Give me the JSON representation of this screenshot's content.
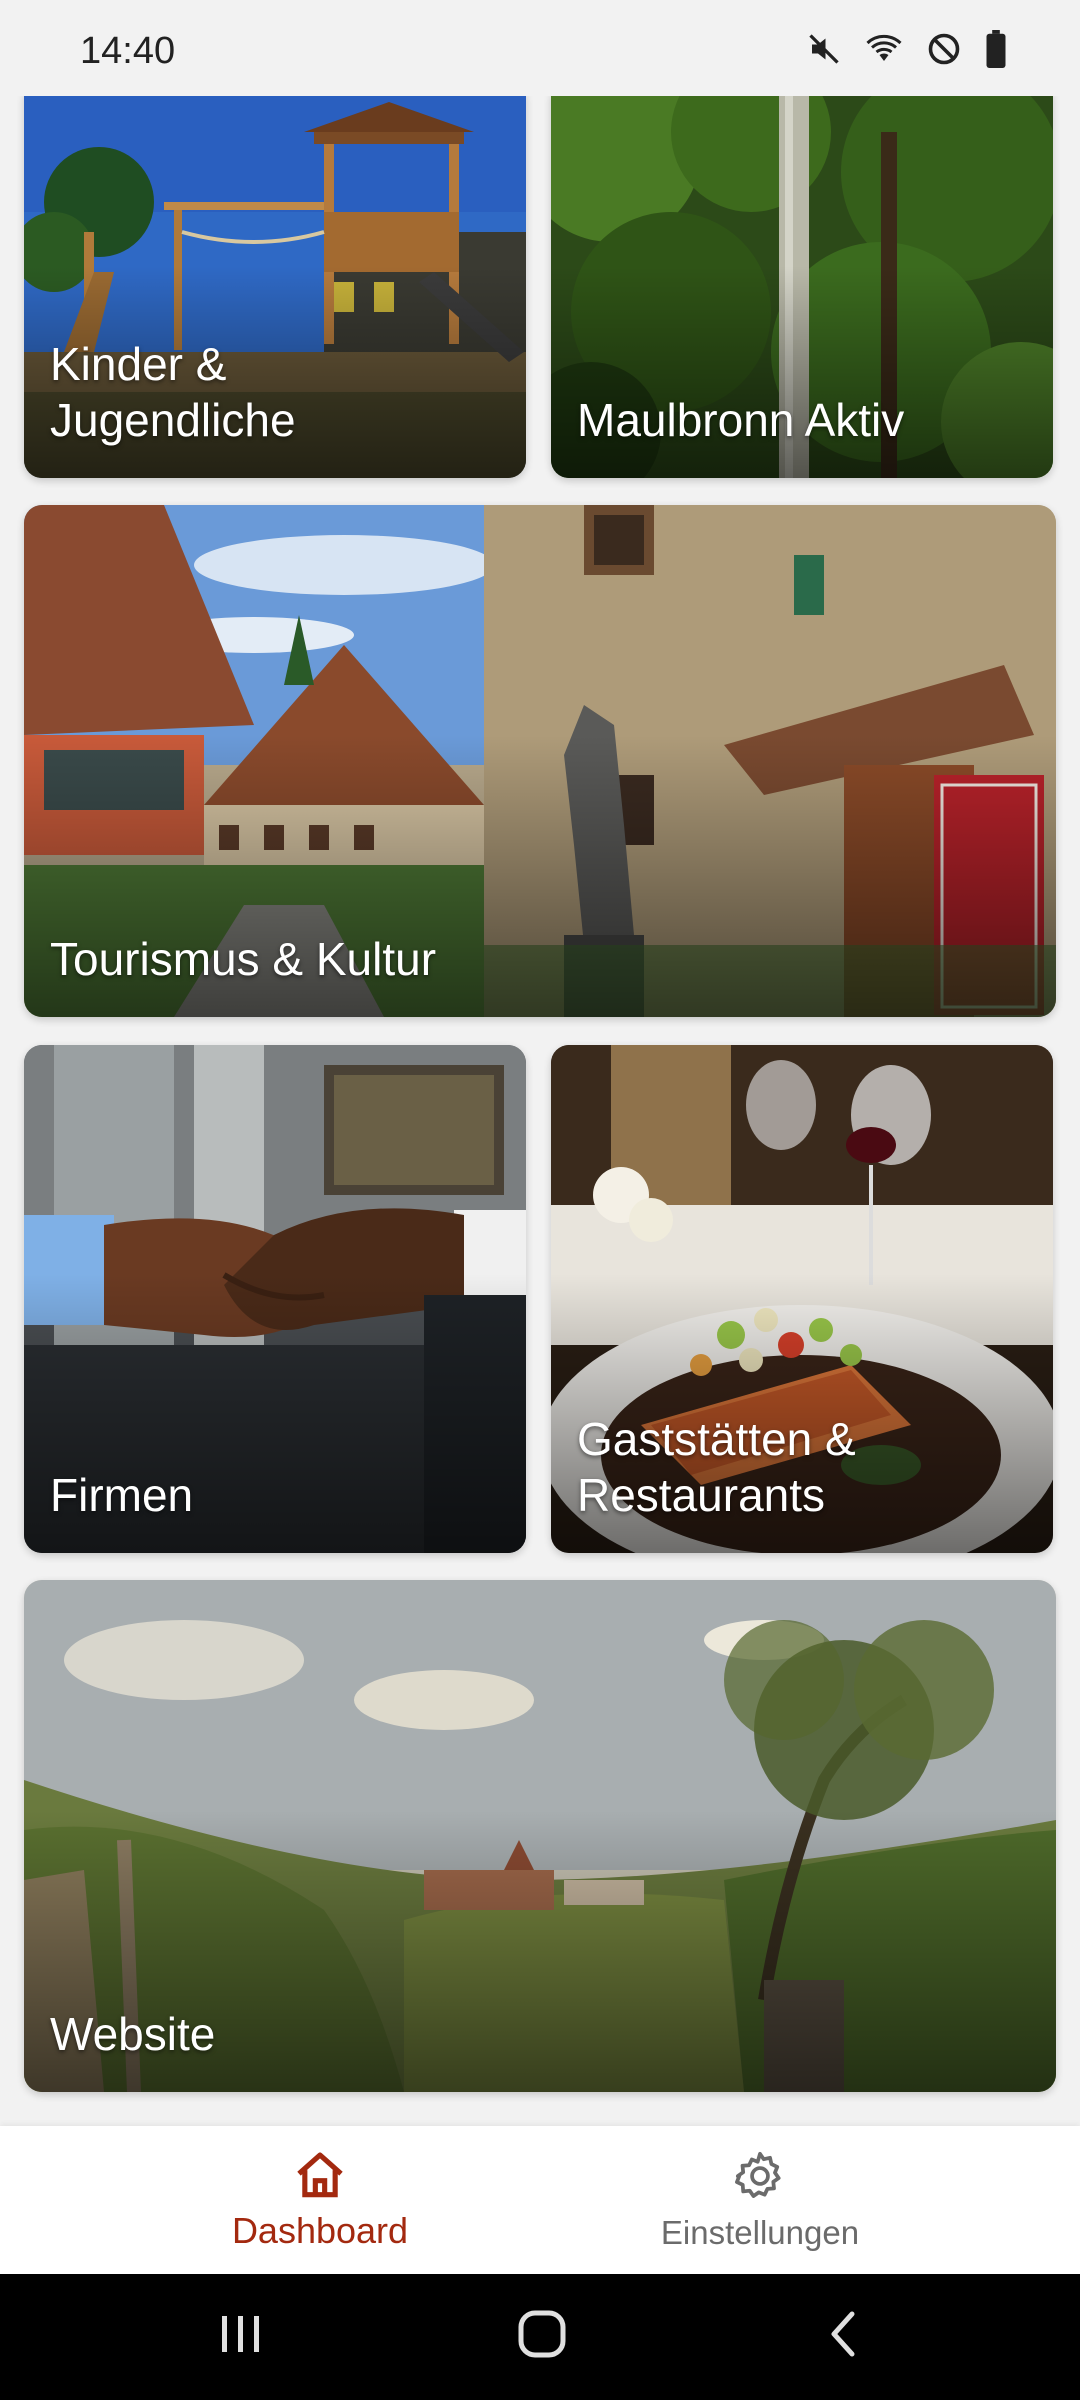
{
  "status_bar": {
    "time": "14:40",
    "icons": [
      "mute-icon",
      "wifi-icon",
      "do-not-disturb-icon",
      "battery-icon"
    ]
  },
  "tiles": [
    {
      "label": "Kinder &\nJugendliche"
    },
    {
      "label": "Maulbronn Aktiv"
    },
    {
      "label": "Tourismus & Kultur"
    },
    {
      "label": "Firmen"
    },
    {
      "label": "Gaststätten &\nRestaurants"
    },
    {
      "label": "Website"
    }
  ],
  "bottom_nav": {
    "items": [
      {
        "label": "Dashboard",
        "icon": "home-icon",
        "active": true
      },
      {
        "label": "Einstellungen",
        "icon": "gear-icon",
        "active": false
      }
    ],
    "accent_color": "#a3290f"
  },
  "system_nav": {
    "icons": [
      "recent-apps-icon",
      "home-circle-icon",
      "back-icon"
    ]
  }
}
